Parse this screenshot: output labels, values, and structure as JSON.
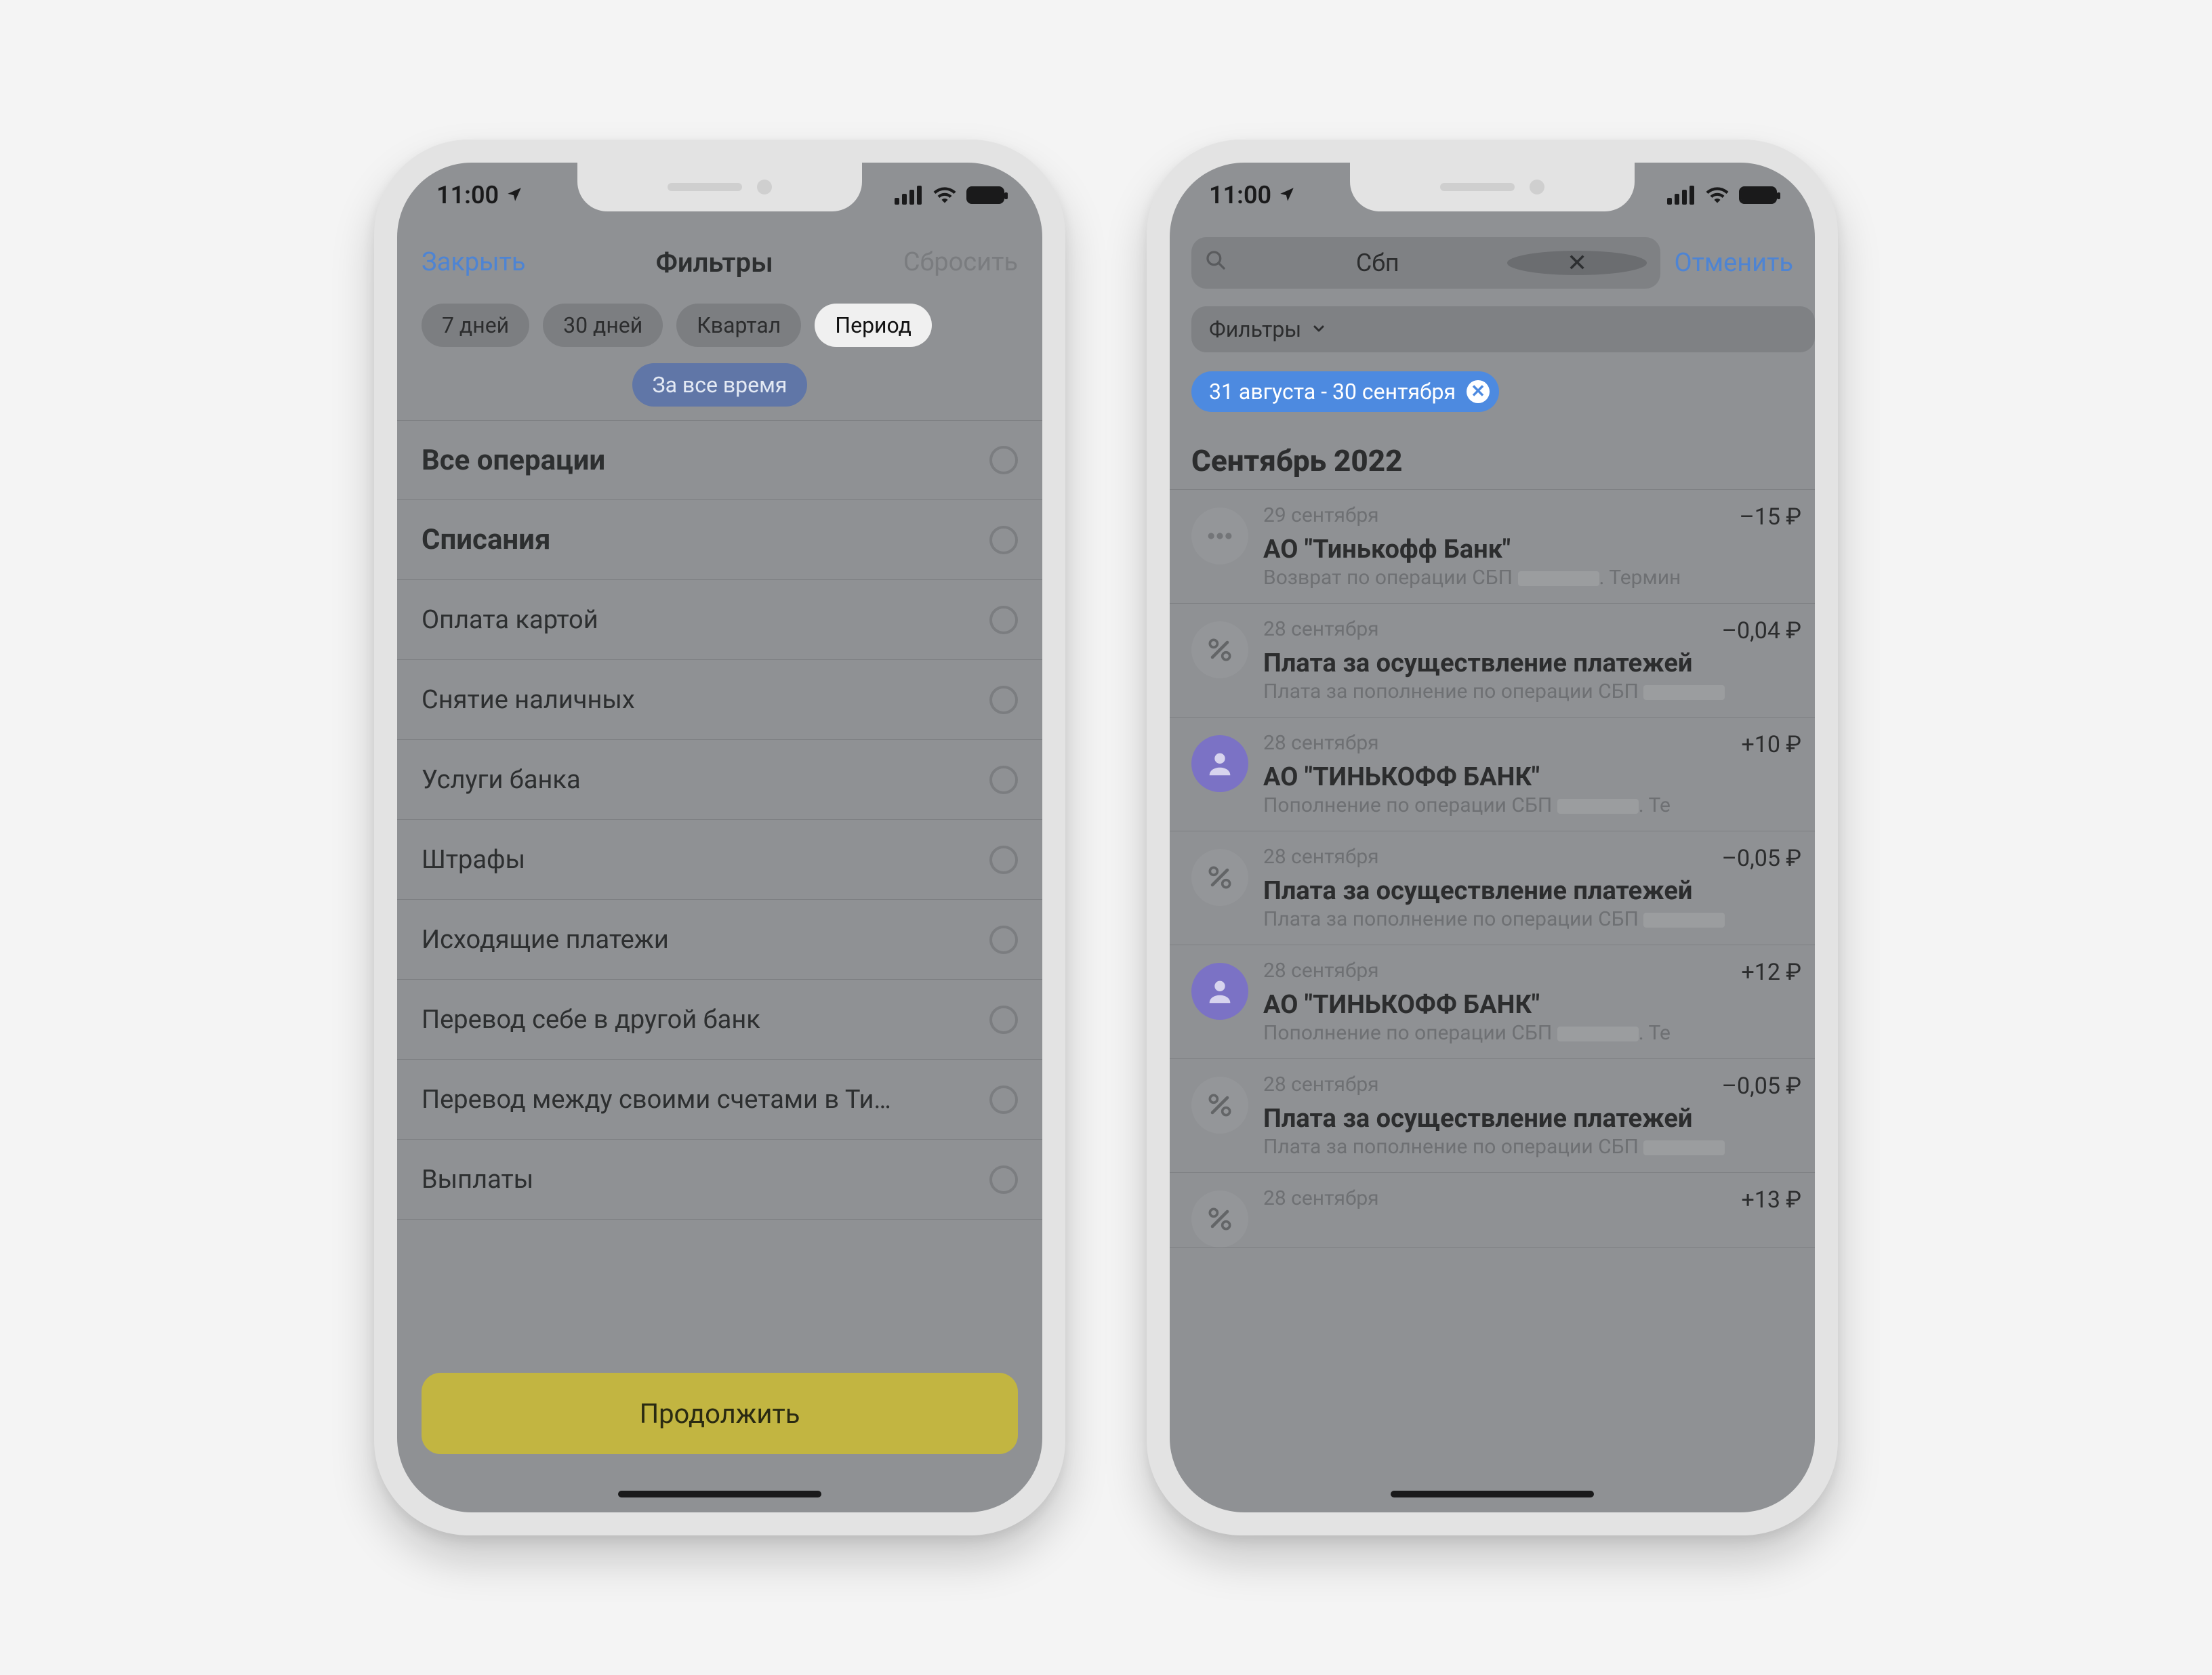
{
  "status": {
    "time": "11:00"
  },
  "left": {
    "header": {
      "close": "Закрыть",
      "title": "Фильтры",
      "reset": "Сбросить"
    },
    "chips": [
      "7 дней",
      "30 дней",
      "Квартал",
      "Период"
    ],
    "chip_selected_index": 3,
    "chip_all_time": "За все время",
    "options": [
      {
        "label": "Все операции",
        "bold": true
      },
      {
        "label": "Списания",
        "bold": true
      },
      {
        "label": "Оплата картой"
      },
      {
        "label": "Снятие наличных"
      },
      {
        "label": "Услуги банка"
      },
      {
        "label": "Штрафы"
      },
      {
        "label": "Исходящие платежи"
      },
      {
        "label": "Перевод себе в другой банк"
      },
      {
        "label": "Перевод между своими счетами в Ти…"
      },
      {
        "label": "Выплаты"
      }
    ],
    "cta": "Продолжить"
  },
  "right": {
    "search": {
      "value": "Сбп",
      "cancel": "Отменить"
    },
    "filter_chip": "Фильтры",
    "pill": "31 августа - 30 сентября",
    "month": "Сентябрь 2022",
    "tx": [
      {
        "date": "29 сентября",
        "amount": "–15 ₽",
        "title": "АО \"Тинькофф Банк\"",
        "sub_pre": "Возврат по операции СБП",
        "sub_post": ". Термин",
        "kind": "dots"
      },
      {
        "date": "28 сентября",
        "amount": "–0,04 ₽",
        "title": "Плата за осуществление платежей",
        "sub_pre": "Плата за пополнение по операции СБП",
        "sub_post": "",
        "kind": "percent"
      },
      {
        "date": "28 сентября",
        "amount": "+10 ₽",
        "title": "АО \"ТИНЬКОФФ БАНК\"",
        "sub_pre": "Пополнение по операции СБП",
        "sub_post": ". Те",
        "kind": "person"
      },
      {
        "date": "28 сентября",
        "amount": "–0,05 ₽",
        "title": "Плата за осуществление платежей",
        "sub_pre": "Плата за пополнение по операции СБП",
        "sub_post": "",
        "kind": "percent"
      },
      {
        "date": "28 сентября",
        "amount": "+12 ₽",
        "title": "АО \"ТИНЬКОФФ БАНК\"",
        "sub_pre": "Пополнение по операции СБП",
        "sub_post": ". Те",
        "kind": "person"
      },
      {
        "date": "28 сентября",
        "amount": "–0,05 ₽",
        "title": "Плата за осуществление платежей",
        "sub_pre": "Плата за пополнение по операции СБП",
        "sub_post": "",
        "kind": "percent"
      },
      {
        "date": "28 сентября",
        "amount": "+13 ₽",
        "title": "",
        "sub_pre": "",
        "sub_post": "",
        "kind": "cut"
      }
    ]
  }
}
